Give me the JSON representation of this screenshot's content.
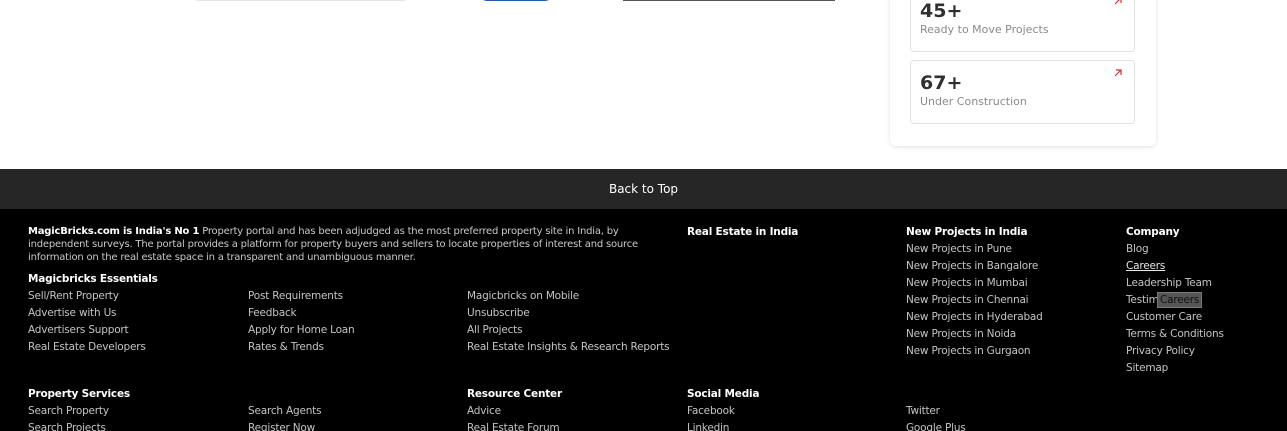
{
  "stats": [
    {
      "number": "45+",
      "label": "Ready to Move Projects"
    },
    {
      "number": "67+",
      "label": "Under Construction"
    }
  ],
  "back_to_top": "Back to Top",
  "about": {
    "bold": "MagicBricks.com is India's No 1",
    "text": " Property portal and has been adjudged as the most preferred property site in India, by independent surveys. The portal provides a platform for property buyers and sellers to locate properties of interest and source information on the real estate space in a transparent and unambiguous manner."
  },
  "essentials": {
    "heading": "Magicbricks Essentials",
    "col1": [
      "Sell/Rent Property",
      "Advertise with Us",
      "Advertisers Support",
      "Real Estate Developers"
    ],
    "col2": [
      "Post Requirements",
      "Feedback",
      "Apply for Home Loan",
      "Rates & Trends"
    ],
    "col3": [
      "Magicbricks on Mobile",
      "Unsubscribe",
      "All Projects",
      "Real Estate Insights & Research Reports"
    ]
  },
  "real_estate_india": {
    "heading": "Real Estate in India"
  },
  "new_projects": {
    "heading": "New Projects in India",
    "items": [
      "New Projects in Pune",
      "New Projects in Bangalore",
      "New Projects in Mumbai",
      "New Projects in Chennai",
      "New Projects in Hyderabad",
      "New Projects in Noida",
      "New Projects in Gurgaon"
    ]
  },
  "company": {
    "heading": "Company",
    "items": [
      "Blog",
      "Careers",
      "Leadership Team",
      "Testim",
      "Customer Care",
      "Terms & Conditions",
      "Privacy Policy",
      "Sitemap"
    ],
    "tooltip": "Careers"
  },
  "property_services": {
    "heading": "Property Services",
    "col1": [
      "Search Property",
      "Search Projects"
    ],
    "col2": [
      "Search Agents",
      "Register Now"
    ]
  },
  "resource_center": {
    "heading": "Resource Center",
    "items": [
      "Advice",
      "Real Estate Forum"
    ]
  },
  "social_media": {
    "heading": "Social Media",
    "col1": [
      "Facebook",
      "Linkedin"
    ],
    "col2": [
      "Twitter",
      "Google Plus"
    ]
  },
  "colors": {
    "footer_bg": "#000000",
    "back_top_bg": "#262626",
    "arrow": "#d32f2f"
  }
}
